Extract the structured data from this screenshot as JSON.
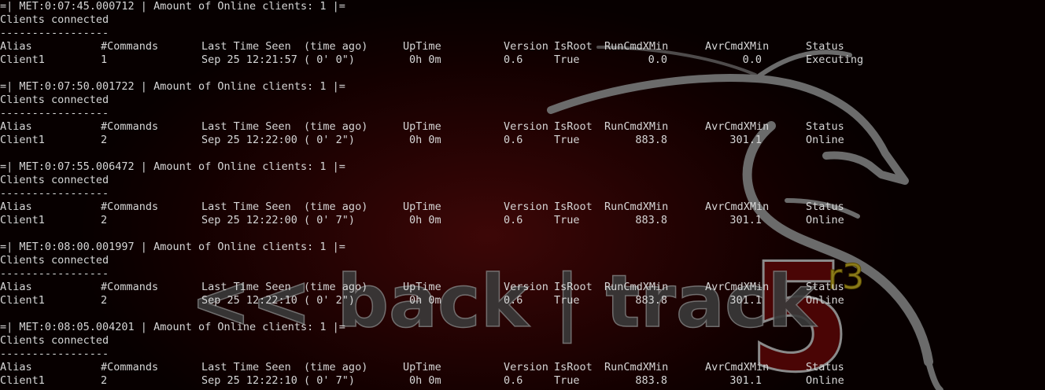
{
  "wallpaper": {
    "logo_text": "<< back | track",
    "version_number": "5",
    "version_suffix": "r3"
  },
  "blocks": [
    {
      "met_line": "=| MET:0:07:45.000712 | Amount of Online clients: 1 |=",
      "title": "Clients connected",
      "separator": "-----------------",
      "headers": [
        "Alias",
        "#Commands",
        "Last Time Seen  (time ago)",
        "UpTime",
        "Version",
        "IsRoot",
        "RunCmdXMin",
        "AvrCmdXMin",
        "Status"
      ],
      "row": {
        "alias": "Client1",
        "commands": "1",
        "last_seen": "Sep 25 12:21:57 ( 0' 0\")",
        "uptime": "0h 0m",
        "version": "0.6",
        "isroot": "True",
        "run": "0.0",
        "avr": "0.0",
        "status": "Executing"
      }
    },
    {
      "met_line": "=| MET:0:07:50.001722 | Amount of Online clients: 1 |=",
      "title": "Clients connected",
      "separator": "-----------------",
      "headers": [
        "Alias",
        "#Commands",
        "Last Time Seen  (time ago)",
        "UpTime",
        "Version",
        "IsRoot",
        "RunCmdXMin",
        "AvrCmdXMin",
        "Status"
      ],
      "row": {
        "alias": "Client1",
        "commands": "2",
        "last_seen": "Sep 25 12:22:00 ( 0' 2\")",
        "uptime": "0h 0m",
        "version": "0.6",
        "isroot": "True",
        "run": "883.8",
        "avr": "301.1",
        "status": "Online"
      }
    },
    {
      "met_line": "=| MET:0:07:55.006472 | Amount of Online clients: 1 |=",
      "title": "Clients connected",
      "separator": "-----------------",
      "headers": [
        "Alias",
        "#Commands",
        "Last Time Seen  (time ago)",
        "UpTime",
        "Version",
        "IsRoot",
        "RunCmdXMin",
        "AvrCmdXMin",
        "Status"
      ],
      "row": {
        "alias": "Client1",
        "commands": "2",
        "last_seen": "Sep 25 12:22:00 ( 0' 7\")",
        "uptime": "0h 0m",
        "version": "0.6",
        "isroot": "True",
        "run": "883.8",
        "avr": "301.1",
        "status": "Online"
      }
    },
    {
      "met_line": "=| MET:0:08:00.001997 | Amount of Online clients: 1 |=",
      "title": "Clients connected",
      "separator": "-----------------",
      "headers": [
        "Alias",
        "#Commands",
        "Last Time Seen  (time ago)",
        "UpTime",
        "Version",
        "IsRoot",
        "RunCmdXMin",
        "AvrCmdXMin",
        "Status"
      ],
      "row": {
        "alias": "Client1",
        "commands": "2",
        "last_seen": "Sep 25 12:22:10 ( 0' 2\")",
        "uptime": "0h 0m",
        "version": "0.6",
        "isroot": "True",
        "run": "883.8",
        "avr": "301.1",
        "status": "Online"
      }
    },
    {
      "met_line": "=| MET:0:08:05.004201 | Amount of Online clients: 1 |=",
      "title": "Clients connected",
      "separator": "-----------------",
      "headers": [
        "Alias",
        "#Commands",
        "Last Time Seen  (time ago)",
        "UpTime",
        "Version",
        "IsRoot",
        "RunCmdXMin",
        "AvrCmdXMin",
        "Status"
      ],
      "row": {
        "alias": "Client1",
        "commands": "2",
        "last_seen": "Sep 25 12:22:10 ( 0' 7\")",
        "uptime": "0h 0m",
        "version": "0.6",
        "isroot": "True",
        "run": "883.8",
        "avr": "301.1",
        "status": "Online"
      }
    }
  ]
}
